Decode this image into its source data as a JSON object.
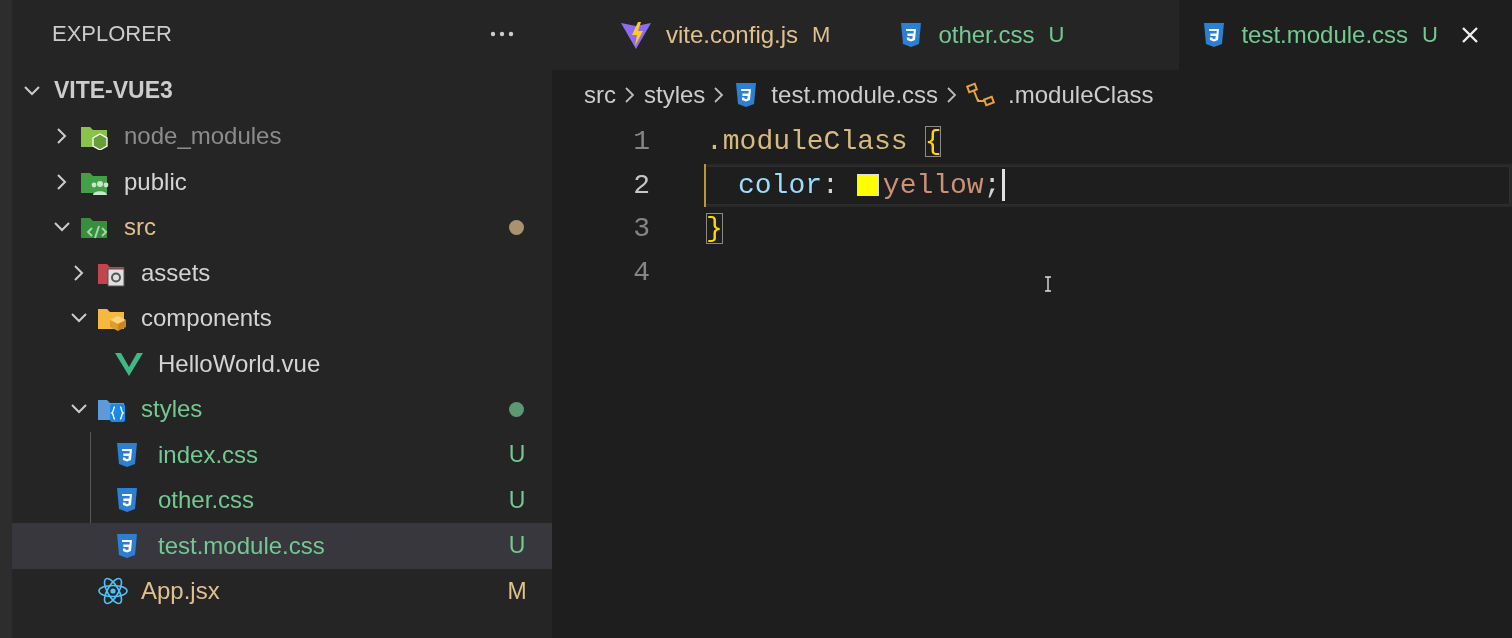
{
  "explorer": {
    "title": "EXPLORER",
    "root": {
      "label": "VITE-VUE3",
      "expanded": true
    },
    "tree": [
      {
        "label": "node_modules",
        "kind": "nodefolder",
        "expanded": false,
        "color": "#8c8c8c",
        "selected": false
      },
      {
        "label": "public",
        "kind": "publicfolder",
        "expanded": false,
        "color": "#d4d4d4",
        "selected": false
      },
      {
        "label": "src",
        "kind": "srcfolder",
        "expanded": true,
        "color": "#e2c08d",
        "dot": true,
        "selected": false,
        "children": [
          {
            "label": "assets",
            "kind": "assetsfolder",
            "expanded": false,
            "color": "#d4d4d4",
            "selected": false
          },
          {
            "label": "components",
            "kind": "componentsfolder",
            "expanded": true,
            "color": "#d4d4d4",
            "selected": false,
            "children": [
              {
                "label": "HelloWorld.vue",
                "kind": "vue",
                "color": "#d4d4d4",
                "selected": false
              }
            ]
          },
          {
            "label": "styles",
            "kind": "stylesfolder",
            "expanded": true,
            "color": "#73c991",
            "dot": true,
            "selected": false,
            "children": [
              {
                "label": "index.css",
                "kind": "css",
                "color": "#73c991",
                "badge": "U",
                "selected": false
              },
              {
                "label": "other.css",
                "kind": "css",
                "color": "#73c991",
                "badge": "U",
                "selected": false
              },
              {
                "label": "test.module.css",
                "kind": "css",
                "color": "#73c991",
                "badge": "U",
                "selected": true
              }
            ]
          },
          {
            "label": "App.jsx",
            "kind": "react",
            "color": "#e2c08d",
            "badge": "M",
            "selected": false
          }
        ]
      }
    ]
  },
  "tabs": [
    {
      "label": "vite.config.js",
      "kind": "vite",
      "badge": "M",
      "color": "#e2c08d",
      "selected": false
    },
    {
      "label": "other.css",
      "kind": "css",
      "badge": "U",
      "color": "#73c991",
      "selected": false
    },
    {
      "label": "test.module.css",
      "kind": "css",
      "badge": "U",
      "color": "#73c991",
      "selected": true
    }
  ],
  "breadcrumbs": [
    {
      "label": "src",
      "kind": "folder"
    },
    {
      "label": "styles",
      "kind": "folder"
    },
    {
      "label": "test.module.css",
      "kind": "css"
    },
    {
      "label": ".moduleClass",
      "kind": "symbol"
    }
  ],
  "code": [
    {
      "number": "1",
      "current": false,
      "tokens": [
        {
          "text": ".moduleClass",
          "kind": "selector"
        },
        {
          "text": "{",
          "kind": "brace",
          "matched": true
        }
      ]
    },
    {
      "number": "2",
      "current": true,
      "tokens": [
        {
          "text": "color",
          "kind": "property"
        },
        {
          "text": ":",
          "kind": "punct"
        },
        {
          "kind": "swatch",
          "color": "#ffff00"
        },
        {
          "text": "yellow",
          "kind": "value"
        },
        {
          "text": ";",
          "kind": "punct"
        },
        {
          "kind": "caret"
        }
      ]
    },
    {
      "number": "3",
      "current": false,
      "tokens": [
        {
          "text": "}",
          "kind": "brace",
          "matched": true
        }
      ]
    },
    {
      "number": "4",
      "current": false
    }
  ]
}
